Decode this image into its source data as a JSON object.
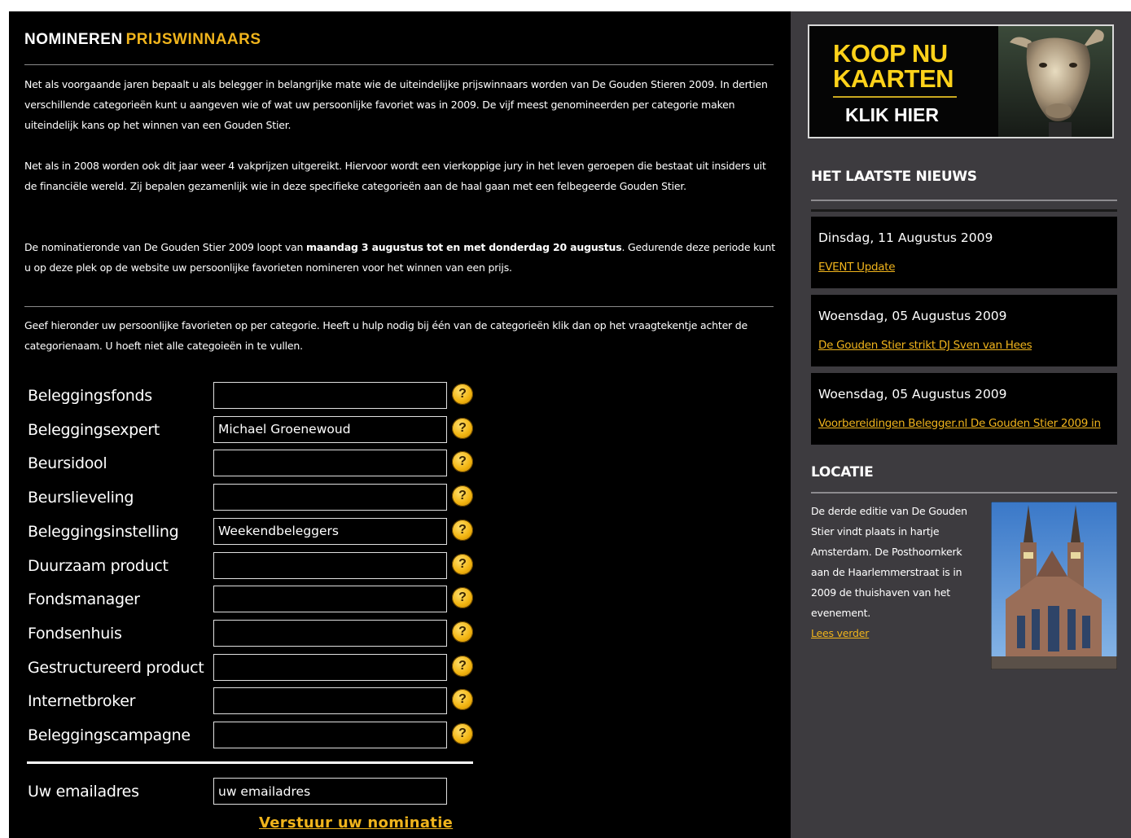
{
  "header": {
    "title_part1": "NOMINEREN",
    "title_part2": "PRIJSWINNAARS"
  },
  "intro": {
    "p1": "Net als voorgaande jaren bepaalt u als belegger in belangrijke mate wie de uiteindelijke prijswinnaars worden van De Gouden Stieren 2009. In dertien verschillende categorieën kunt u aangeven wie of wat uw persoonlijke favoriet was in 2009. De vijf meest genomineerden per categorie maken uiteindelijk kans op het winnen van een Gouden Stier.",
    "p2": "Net als in 2008 worden ook dit jaar weer 4 vakprijzen uitgereikt. Hiervoor wordt een vierkoppige jury in het leven geroepen die bestaat uit insiders uit de financiële wereld. Zij bepalen gezamenlijk wie in deze specifieke categorieën aan de haal gaan met een felbegeerde Gouden Stier.",
    "p3_start": "De nominatieronde van De Gouden Stier 2009 loopt van ",
    "p3_bold": "maandag 3 augustus tot en met donderdag 20 augustus",
    "p3_end": ". Gedurende deze periode kunt u op deze plek op de website uw persoonlijke favorieten nomineren voor het winnen van een prijs.",
    "p4": "Geef hieronder uw persoonlijke favorieten op per categorie. Heeft u hulp nodig bij één van de categorieën klik dan op het vraagtekentje achter de categorienaam. U hoeft niet alle categoieën in te vullen."
  },
  "form": {
    "fields": [
      {
        "label": "Beleggingsfonds",
        "value": ""
      },
      {
        "label": "Beleggingsexpert",
        "value": "Michael Groenewoud"
      },
      {
        "label": "Beursidool",
        "value": ""
      },
      {
        "label": "Beurslieveling",
        "value": ""
      },
      {
        "label": "Beleggingsinstelling",
        "value": "Weekendbeleggers"
      },
      {
        "label": "Duurzaam product",
        "value": ""
      },
      {
        "label": "Fondsmanager",
        "value": ""
      },
      {
        "label": "Fondsenhuis",
        "value": ""
      },
      {
        "label": "Gestructureerd product",
        "value": ""
      },
      {
        "label": "Internetbroker",
        "value": ""
      },
      {
        "label": "Beleggingscampagne",
        "value": ""
      }
    ],
    "help_glyph": "?",
    "email_label": "Uw emailadres",
    "email_value": "uw emailadres",
    "submit_label": "Verstuur uw nominatie"
  },
  "sidebar": {
    "banner": {
      "line1": "KOOP NU",
      "line2": "KAARTEN",
      "cta": "KLIK HIER",
      "image_icon": "golden-bull-statue"
    },
    "news_heading": "HET LAATSTE NIEUWS",
    "news": [
      {
        "date": "Dinsdag, 11 Augustus 2009",
        "link": "EVENT Update"
      },
      {
        "date": "Woensdag, 05 Augustus 2009",
        "link": "De Gouden Stier strikt DJ Sven van Hees"
      },
      {
        "date": "Woensdag, 05 Augustus 2009",
        "link": "Voorbereidingen Belegger.nl De Gouden Stier 2009 in"
      }
    ],
    "location_heading": "LOCATIE",
    "location_text": "De derde editie van De Gouden Stier vindt plaats in hartje Amsterdam. De Posthoornkerk aan de Haarlemmerstraat is in 2009 de thuishaven van het evenement.",
    "location_link": "Lees verder",
    "location_image": "posthoornkerk-church-photo"
  },
  "colors": {
    "accent_gold": "#f0b41c",
    "main_bg": "#000000",
    "sidebar_bg": "#3d3b3f"
  }
}
